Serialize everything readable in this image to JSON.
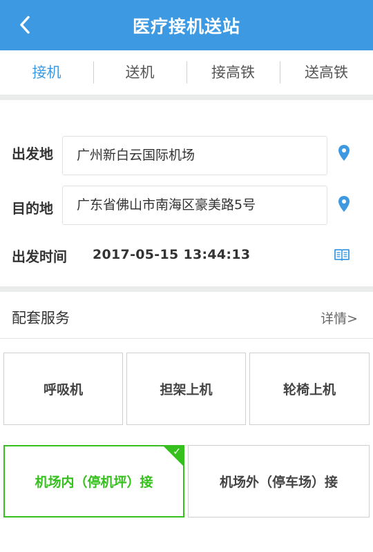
{
  "header": {
    "title": "医疗接机送站"
  },
  "tabs": [
    {
      "label": "接机",
      "active": true
    },
    {
      "label": "送机",
      "active": false
    },
    {
      "label": "接高铁",
      "active": false
    },
    {
      "label": "送高铁",
      "active": false
    }
  ],
  "form": {
    "departure": {
      "label": "出发地",
      "value": "广州新白云国际机场"
    },
    "destination": {
      "label": "目的地",
      "value": "广东省佛山市南海区豪美路5号"
    },
    "time": {
      "label": "出发时间",
      "value": "2017-05-15 13:44:13"
    }
  },
  "services": {
    "title": "配套服务",
    "detail_label": "详情>",
    "options": [
      {
        "label": "呼吸机"
      },
      {
        "label": "担架上机"
      },
      {
        "label": "轮椅上机"
      }
    ],
    "pickup_options": [
      {
        "label": "机场内（停机坪）接",
        "selected": true
      },
      {
        "label": "机场外（停车场）接",
        "selected": false
      }
    ]
  },
  "colors": {
    "primary": "#3d9ae2",
    "selected": "#36c01d",
    "divider": "#e9eceb"
  },
  "icons": {
    "back": "chevron-left-icon",
    "location": "map-pin-icon",
    "calendar": "book-icon",
    "check": "checkmark-icon"
  }
}
